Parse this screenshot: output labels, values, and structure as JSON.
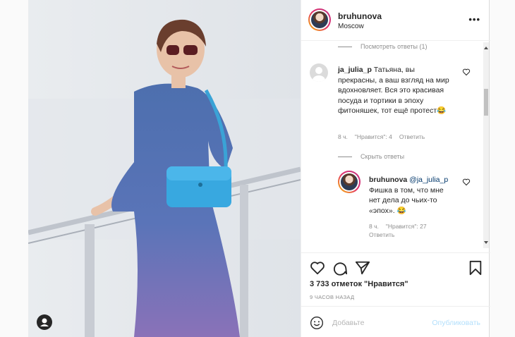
{
  "post": {
    "author": "bruhunova",
    "location": "Moscow",
    "more_icon": "more-horizontal-icon"
  },
  "comments": {
    "view_replies_top": "Посмотреть ответы (1)",
    "main": {
      "username": "ja_julia_p",
      "text": "Татьяна, вы прекрасны, а ваш взгляд на мир вдохновляет. Вся это красивая посуда и тортики в эпоху фитоняшек, тот ещё протест😂",
      "time": "8 ч.",
      "likes": "\"Нравится\": 4",
      "reply": "Ответить"
    },
    "hide_replies": "Скрыть ответы",
    "reply_comment": {
      "username": "bruhunova",
      "mention": "@ja_julia_p",
      "text": "Фишка в том, что мне нет дела до чьих-то «эпох». 😂",
      "time": "8 ч.",
      "likes": "\"Нравится\": 27",
      "reply": "Ответить"
    }
  },
  "actions": {
    "likes_count": "3 733 отметок \"Нравится\"",
    "time_ago": "9 часов назад"
  },
  "composer": {
    "placeholder": "Добавьте",
    "post_label": "Опубликовать"
  },
  "colors": {
    "link_blue_disabled": "#b2dffc",
    "mention": "#00376b",
    "meta_gray": "#8e8e8e"
  }
}
